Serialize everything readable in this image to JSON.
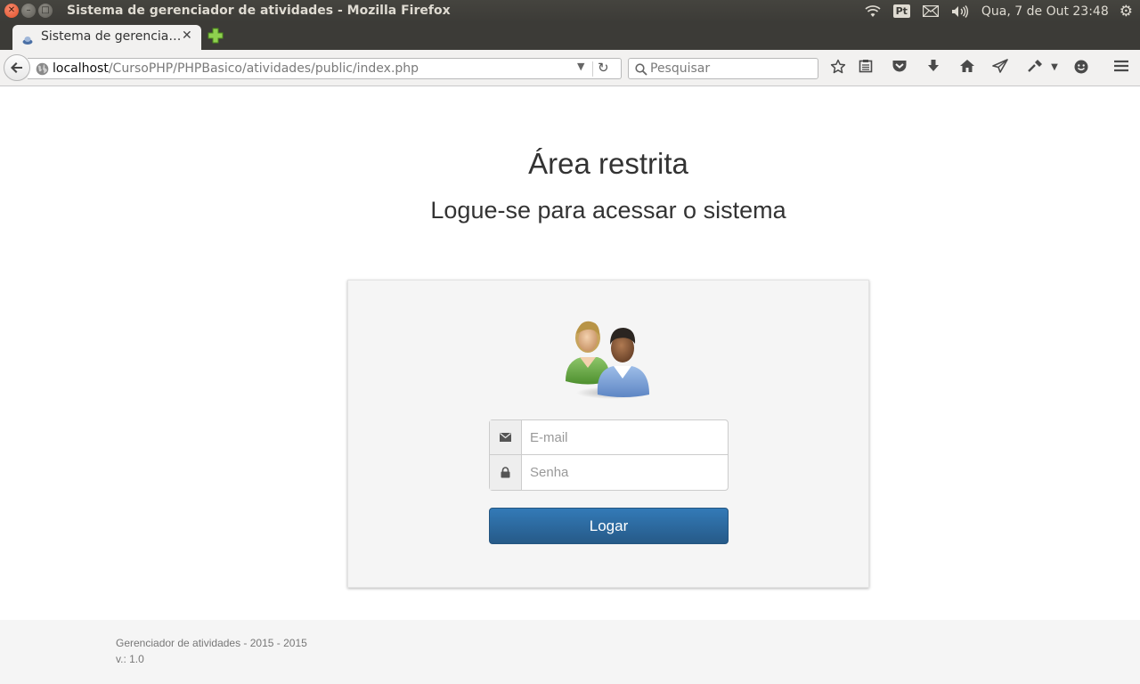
{
  "window": {
    "title": "Sistema de gerenciador de atividades - Mozilla Firefox",
    "close_glyph": "✕",
    "min_glyph": "–",
    "max_glyph": "□"
  },
  "system_tray": {
    "keyboard_layout": "Pt",
    "clock": "Qua,  7 de Out 23:48"
  },
  "browser": {
    "tab": {
      "label": "Sistema de gerencia…",
      "close_glyph": "✕"
    },
    "url": {
      "host": "localhost",
      "path": "/CursoPHP/PHPBasico/atividades/public/index.php"
    },
    "search": {
      "placeholder": "Pesquisar"
    }
  },
  "page": {
    "heading": "Área restrita",
    "subheading": "Logue-se para acessar o sistema",
    "form": {
      "email_placeholder": "E-mail",
      "password_placeholder": "Senha",
      "submit_label": "Logar"
    },
    "footer": {
      "line1": "Gerenciador de atividades - 2015 - 2015",
      "line2": "v.: 1.0"
    }
  },
  "colors": {
    "button_primary": "#337ab7",
    "panel_background": "#f5f5f5",
    "titlebar": "#3c3b37"
  }
}
